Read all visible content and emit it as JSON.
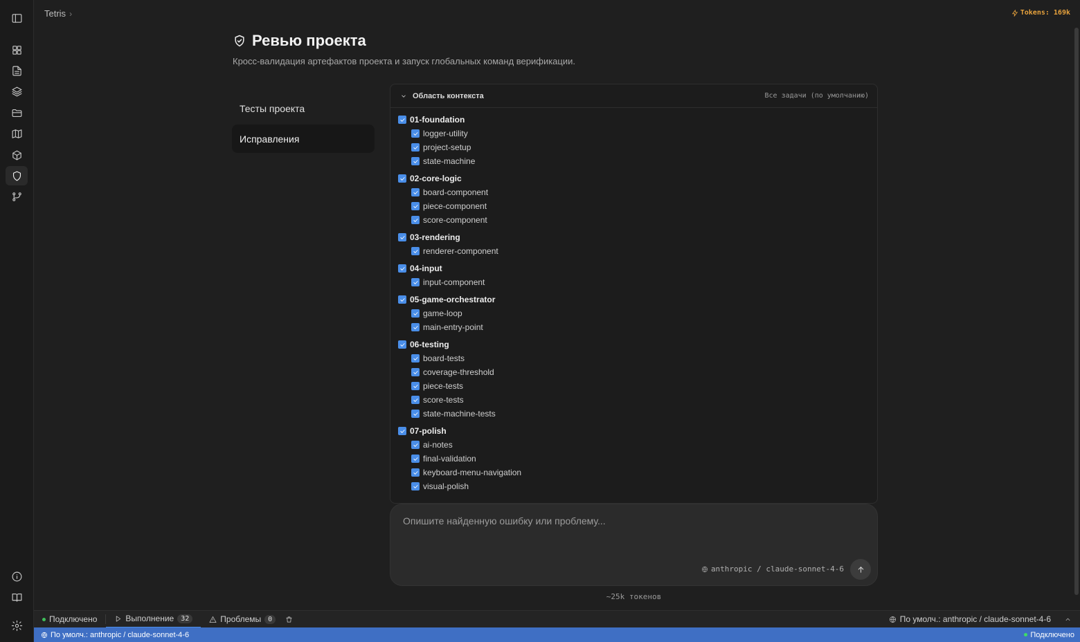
{
  "breadcrumb": {
    "project": "Tetris",
    "separator": "›"
  },
  "tokens_indicator": "Tokens: 169k",
  "header": {
    "title": "Ревью проекта",
    "subtitle": "Кросс-валидация артефактов проекта и запуск глобальных команд верификации."
  },
  "sections": [
    {
      "label": "Тесты проекта",
      "active": false
    },
    {
      "label": "Исправления",
      "active": true
    }
  ],
  "context": {
    "title": "Область контекста",
    "scope": "Все задачи (по умолчанию)",
    "groups": [
      {
        "name": "01-foundation",
        "tasks": [
          "logger-utility",
          "project-setup",
          "state-machine"
        ]
      },
      {
        "name": "02-core-logic",
        "tasks": [
          "board-component",
          "piece-component",
          "score-component"
        ]
      },
      {
        "name": "03-rendering",
        "tasks": [
          "renderer-component"
        ]
      },
      {
        "name": "04-input",
        "tasks": [
          "input-component"
        ]
      },
      {
        "name": "05-game-orchestrator",
        "tasks": [
          "game-loop",
          "main-entry-point"
        ]
      },
      {
        "name": "06-testing",
        "tasks": [
          "board-tests",
          "coverage-threshold",
          "piece-tests",
          "score-tests",
          "state-machine-tests"
        ]
      },
      {
        "name": "07-polish",
        "tasks": [
          "ai-notes",
          "final-validation",
          "keyboard-menu-navigation",
          "visual-polish"
        ]
      }
    ]
  },
  "composer": {
    "placeholder": "Опишите найденную ошибку или проблему...",
    "model": "anthropic / claude-sonnet-4-6"
  },
  "token_estimate": "~25k токенов",
  "panel": {
    "connected": "Подключено",
    "run_label": "Выполнение",
    "run_count": "32",
    "problems_label": "Проблемы",
    "problems_count": "0",
    "model_default": "По умолч.: anthropic / claude-sonnet-4-6"
  },
  "status_bar": {
    "model_default": "По умолч.: anthropic / claude-sonnet-4-6",
    "connected": "Подключено"
  },
  "colors": {
    "accent": "#4a8ee8",
    "status_bar": "#3f6fc4",
    "tokens": "#e8a33d",
    "connected": "#3fbf5a"
  },
  "icons": {
    "rail_top": [
      "sidebar-toggle-icon",
      "grid-icon",
      "file-text-icon",
      "layers-icon",
      "folder-icon",
      "map-icon",
      "package-icon",
      "shield-icon",
      "git-branch-icon"
    ],
    "rail_bottom": [
      "info-icon",
      "book-icon",
      "gear-icon"
    ]
  }
}
